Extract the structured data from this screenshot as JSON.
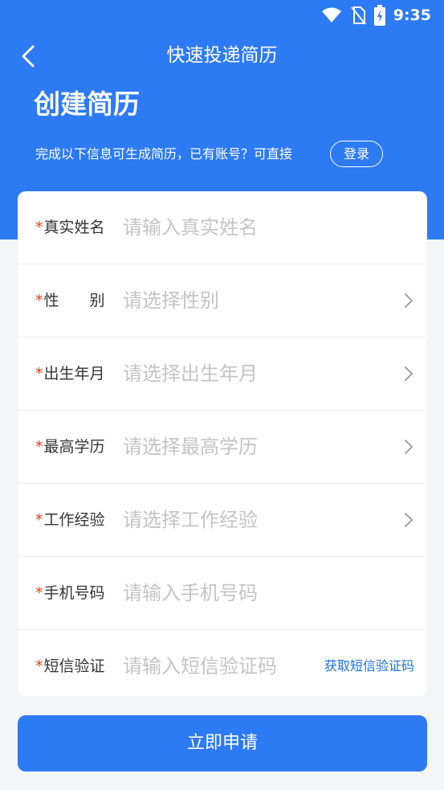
{
  "status_bar": {
    "time": "9:35"
  },
  "nav": {
    "title": "快速投递简历"
  },
  "hero": {
    "title": "创建简历",
    "subtitle": "完成以下信息可生成简历，已有账号？可直接",
    "login_label": "登录"
  },
  "form": {
    "rows": [
      {
        "required": "*",
        "label": "真实姓名",
        "placeholder": "请输入真实姓名"
      },
      {
        "required": "*",
        "label": "性　　别",
        "placeholder": "请选择性别"
      },
      {
        "required": "*",
        "label": "出生年月",
        "placeholder": "请选择出生年月"
      },
      {
        "required": "*",
        "label": "最高学历",
        "placeholder": "请选择最高学历"
      },
      {
        "required": "*",
        "label": "工作经验",
        "placeholder": "请选择工作经验"
      },
      {
        "required": "*",
        "label": "手机号码",
        "placeholder": "请输入手机号码"
      },
      {
        "required": "*",
        "label": "短信验证",
        "placeholder": "请输入短信验证码"
      }
    ],
    "sms_button": "获取短信验证码"
  },
  "submit_label": "立即申请",
  "colors": {
    "primary": "#2d7af5",
    "required": "#e23c1f",
    "link": "#1d6fe6",
    "placeholder": "#c4c4c4"
  },
  "icons": [
    "wifi-icon",
    "no-sim-icon",
    "battery-charging-icon",
    "back-arrow-icon",
    "chevron-right-icon"
  ]
}
